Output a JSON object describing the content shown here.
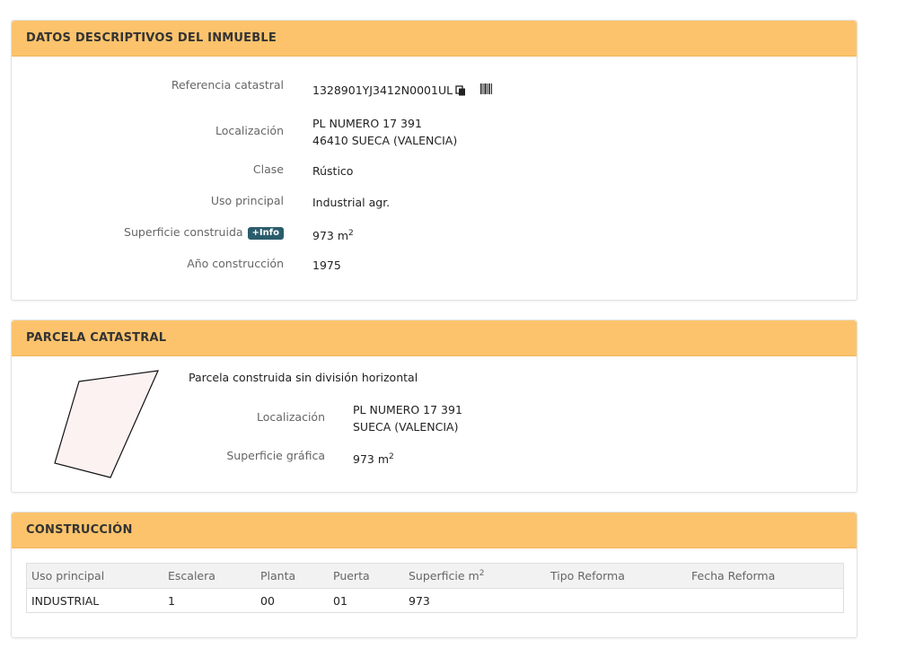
{
  "descriptivos": {
    "title": "DATOS DESCRIPTIVOS DEL INMUEBLE",
    "referencia_label": "Referencia catastral",
    "referencia_value": "1328901YJ3412N0001UL",
    "localizacion_label": "Localización",
    "localizacion_line1": "PL NUMERO 17 391",
    "localizacion_line2": "46410 SUECA (VALENCIA)",
    "clase_label": "Clase",
    "clase_value": "Rústico",
    "uso_label": "Uso principal",
    "uso_value": "Industrial agr.",
    "superficie_label": "Superficie construida",
    "info_badge": "+Info",
    "superficie_value": "973 m",
    "superficie_unit_sup": "2",
    "anio_label": "Año construcción",
    "anio_value": "1975"
  },
  "parcela": {
    "title": "PARCELA CATASTRAL",
    "descripcion": "Parcela construida sin división horizontal",
    "localizacion_label": "Localización",
    "localizacion_line1": "PL NUMERO 17 391",
    "localizacion_line2": "SUECA (VALENCIA)",
    "superficie_label": "Superficie gráfica",
    "superficie_value": "973 m",
    "superficie_unit_sup": "2",
    "shape_fill": "#fdf2f2"
  },
  "construccion": {
    "title": "CONSTRUCCIÓN",
    "columns": [
      "Uso principal",
      "Escalera",
      "Planta",
      "Puerta",
      "Superficie m",
      "Tipo Reforma",
      "Fecha Reforma"
    ],
    "superficie_col_sup": "2",
    "rows": [
      [
        "INDUSTRIAL",
        "1",
        "00",
        "01",
        "973",
        "",
        ""
      ]
    ]
  },
  "colors": {
    "header_bg": "#fcc36c",
    "badge_bg": "#2b5c6b"
  },
  "icons": [
    "copy-icon",
    "barcode-icon"
  ]
}
